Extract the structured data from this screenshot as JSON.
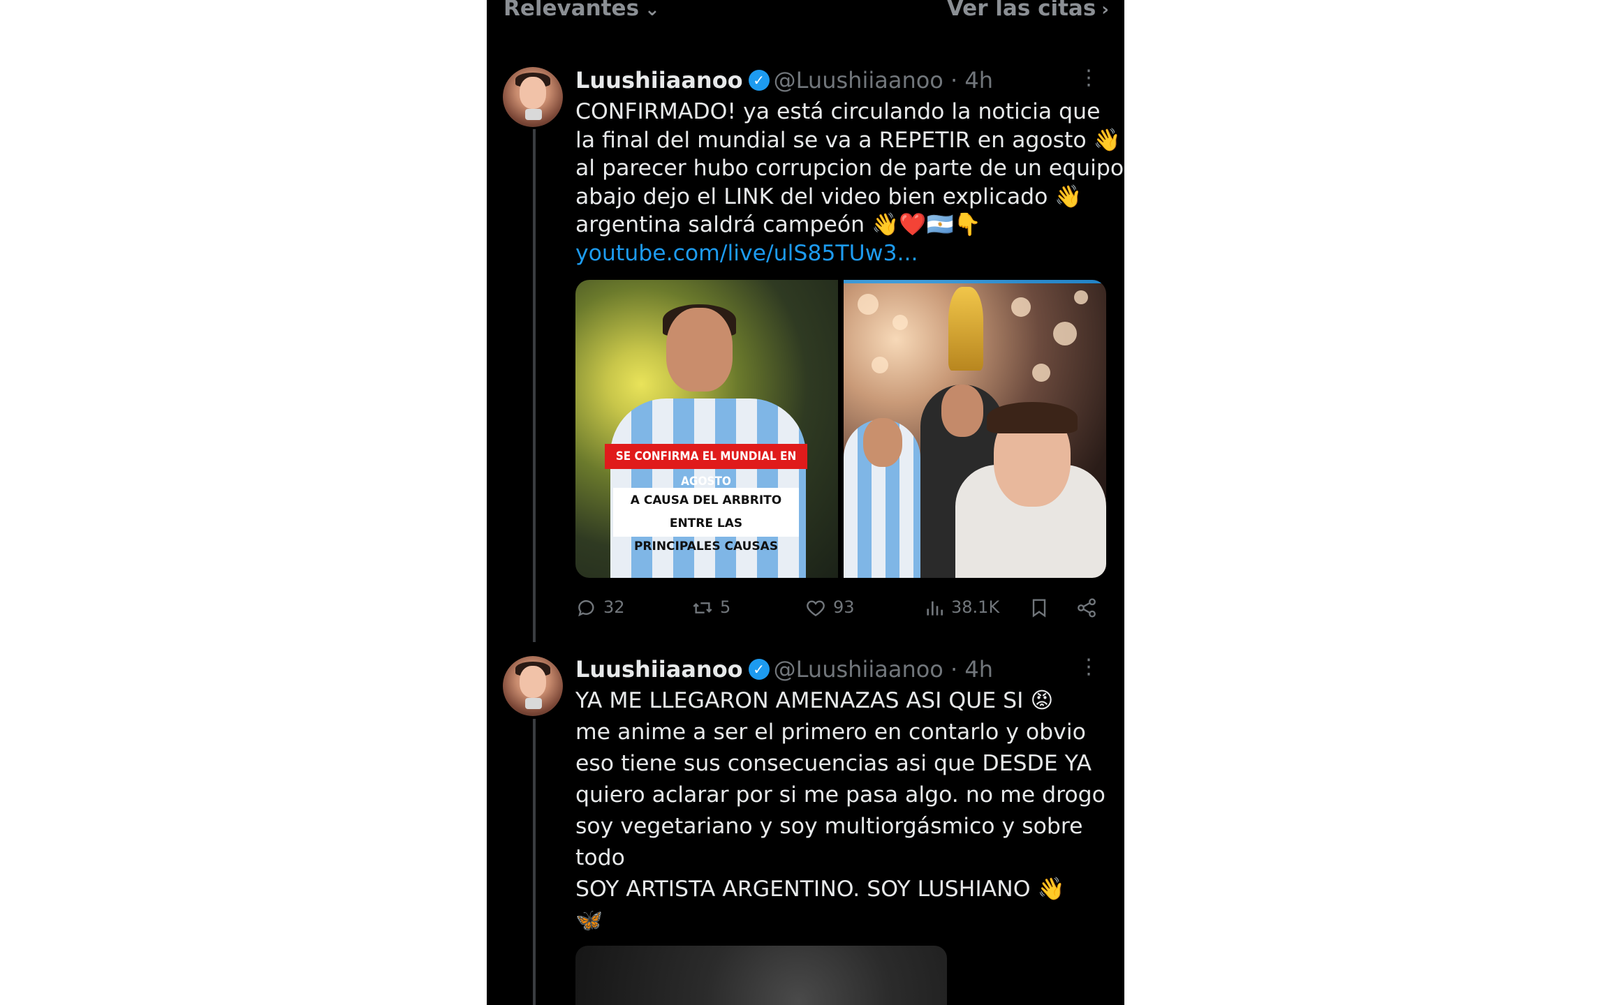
{
  "topbar": {
    "sort_label": "Relevantes",
    "quotes_label": "Ver las citas"
  },
  "tweets": [
    {
      "name": "Luushiiaanoo",
      "handle": "@Luushiiaanoo",
      "separator": "·",
      "time": "4h",
      "lines": [
        "CONFIRMADO! ya está circulando la noticia que",
        "la final del mundial se va a REPETIR en agosto 👋",
        "al parecer hubo corrupcion de parte de un equipo",
        "abajo dejo el LINK del video bien explicado 👋",
        "argentina saldrá campeón 👋❤️🇦🇷👇"
      ],
      "link": "youtube.com/live/ulS85TUw3...",
      "image1_banner": "SE CONFIRMA EL MUNDIAL EN AGOSTO",
      "image1_caption_1": "A CAUSA DEL ARBRITO ENTRE LAS",
      "image1_caption_2": "PRINCIPALES CAUSAS",
      "replies": "32",
      "reposts": "5",
      "likes": "93",
      "views": "38.1K"
    },
    {
      "name": "Luushiiaanoo",
      "handle": "@Luushiiaanoo",
      "separator": "·",
      "time": "4h",
      "lines": [
        "YA ME LLEGARON AMENAZAS ASI QUE SI 😡",
        "me anime a ser el primero en contarlo y obvio",
        "eso tiene sus consecuencias asi que DESDE YA",
        "quiero aclarar por si me pasa algo. no me drogo",
        "soy vegetariano y soy multiorgásmico y sobre",
        "todo",
        "SOY ARTISTA ARGENTINO. SOY LUSHIANO 👋",
        "🦋"
      ]
    }
  ],
  "icons": {
    "verified": "verified-badge-icon",
    "more": "more-options-icon",
    "reply": "reply-icon",
    "repost": "repost-icon",
    "like": "heart-icon",
    "views": "views-chart-icon",
    "bookmark": "bookmark-icon",
    "share": "share-icon"
  },
  "colors": {
    "background": "#000000",
    "link": "#1d9bf0",
    "muted": "#71767b",
    "text": "#e7e9ea"
  }
}
